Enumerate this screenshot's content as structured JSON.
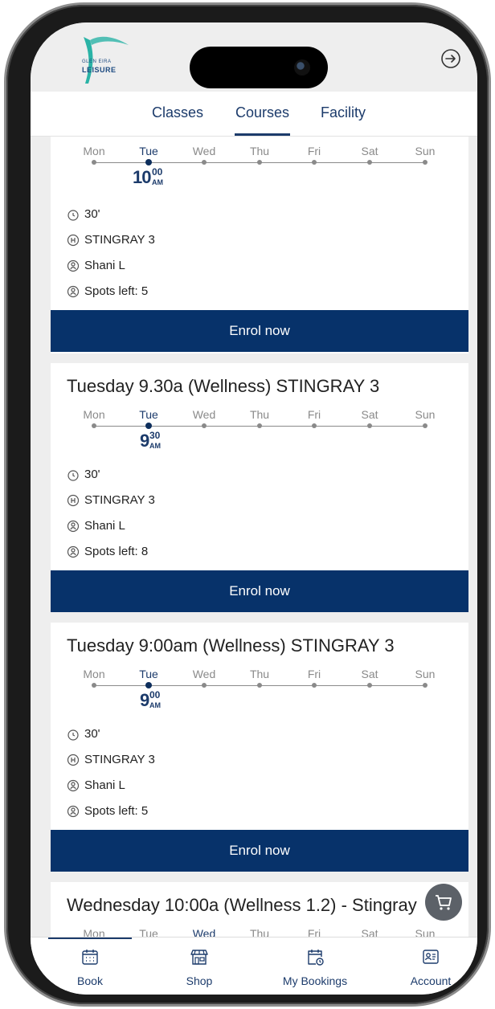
{
  "header": {
    "logo_small": "GLEN EIRA",
    "logo_big": "LEISURE"
  },
  "tabs": [
    {
      "label": "Classes"
    },
    {
      "label": "Courses"
    },
    {
      "label": "Facility"
    }
  ],
  "days": [
    "Mon",
    "Tue",
    "Wed",
    "Thu",
    "Fri",
    "Sat",
    "Sun"
  ],
  "cards": [
    {
      "title": "",
      "time_hour": "10",
      "time_min": "00",
      "time_ampm": "AM",
      "duration": "30'",
      "location": "STINGRAY 3",
      "instructor": "Shani L",
      "spots": "Spots left: 5",
      "button": "Enrol now"
    },
    {
      "title": "Tuesday 9.30a (Wellness) STINGRAY 3",
      "time_hour": "9",
      "time_min": "30",
      "time_ampm": "AM",
      "duration": "30'",
      "location": "STINGRAY 3",
      "instructor": "Shani L",
      "spots": "Spots left: 8",
      "button": "Enrol now"
    },
    {
      "title": "Tuesday 9:00am (Wellness) STINGRAY 3",
      "time_hour": "9",
      "time_min": "00",
      "time_ampm": "AM",
      "duration": "30'",
      "location": "STINGRAY 3",
      "instructor": "Shani L",
      "spots": "Spots left: 5",
      "button": "Enrol now"
    },
    {
      "title": "Wednesday 10:00a (Wellness 1.2) - Stingray"
    }
  ],
  "bottom_nav": [
    {
      "label": "Book",
      "icon": "calendar-grid-icon"
    },
    {
      "label": "Shop",
      "icon": "storefront-icon"
    },
    {
      "label": "My Bookings",
      "icon": "calendar-clock-icon"
    },
    {
      "label": "Account",
      "icon": "id-card-icon"
    }
  ],
  "colors": {
    "brand_navy": "#07326a",
    "brand_text": "#1c3b6b",
    "logo_teal": "#2ab3a6"
  }
}
